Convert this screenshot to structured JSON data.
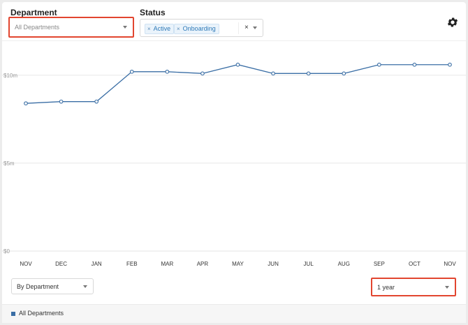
{
  "filters": {
    "department": {
      "label": "Department",
      "placeholder": "All Departments"
    },
    "status": {
      "label": "Status",
      "tags": [
        "Active",
        "Onboarding"
      ],
      "remove_symbol": "×",
      "clear_symbol": "×"
    }
  },
  "settings": {
    "icon": "gear-icon"
  },
  "chart_data": {
    "type": "line",
    "categories": [
      "NOV",
      "DEC",
      "JAN",
      "FEB",
      "MAR",
      "APR",
      "MAY",
      "JUN",
      "JUL",
      "AUG",
      "SEP",
      "OCT",
      "NOV"
    ],
    "series": [
      {
        "values": [
          8.4,
          8.5,
          8.5,
          10.2,
          10.2,
          10.1,
          10.6,
          10.1,
          10.1,
          10.1,
          10.6,
          10.6,
          10.6
        ]
      }
    ],
    "y_ticks": [
      {
        "value": 0,
        "label": "$0"
      },
      {
        "value": 5,
        "label": "$5m"
      },
      {
        "value": 10,
        "label": "$10m"
      }
    ],
    "ylim": [
      0,
      14
    ],
    "grid": true,
    "line_color": "#3a6ea5"
  },
  "controls": {
    "group_by": "By Department",
    "range": "1 year"
  },
  "legend": {
    "label": "All Departments",
    "color": "#3a6ea5"
  }
}
